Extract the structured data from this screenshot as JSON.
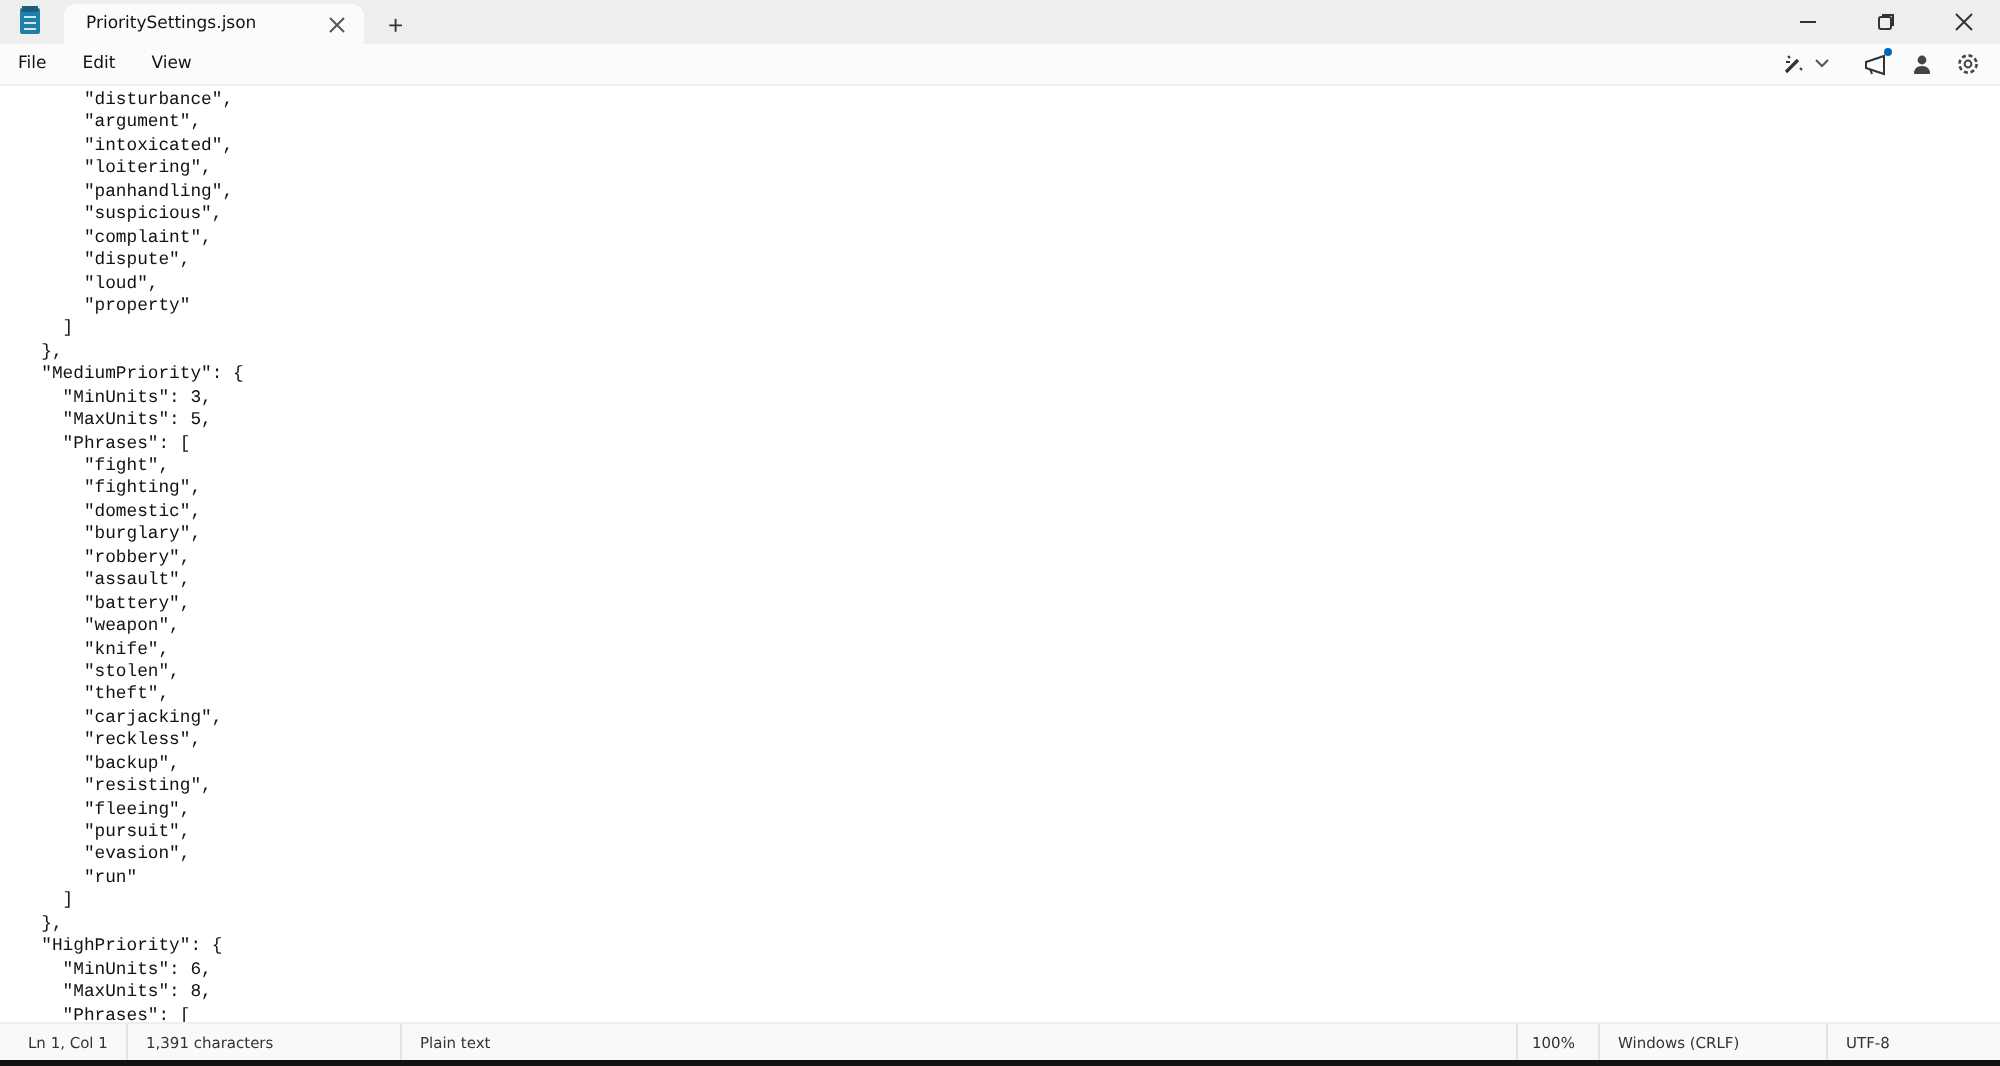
{
  "window": {
    "tab_title": "PrioritySettings.json",
    "tab_selected": true,
    "new_tab": "+"
  },
  "menu": [
    "File",
    "Edit",
    "View"
  ],
  "toolbar": {
    "notification_dot": true
  },
  "editor": {
    "lines": [
      "      \"disturbance\",",
      "      \"argument\",",
      "      \"intoxicated\",",
      "      \"loitering\",",
      "      \"panhandling\",",
      "      \"suspicious\",",
      "      \"complaint\",",
      "      \"dispute\",",
      "      \"loud\",",
      "      \"property\"",
      "    ]",
      "  },",
      "  \"MediumPriority\": {",
      "    \"MinUnits\": 3,",
      "    \"MaxUnits\": 5,",
      "    \"Phrases\": [",
      "      \"fight\",",
      "      \"fighting\",",
      "      \"domestic\",",
      "      \"burglary\",",
      "      \"robbery\",",
      "      \"assault\",",
      "      \"battery\",",
      "      \"weapon\",",
      "      \"knife\",",
      "      \"stolen\",",
      "      \"theft\",",
      "      \"carjacking\",",
      "      \"reckless\",",
      "      \"backup\",",
      "      \"resisting\",",
      "      \"fleeing\",",
      "      \"pursuit\",",
      "      \"evasion\",",
      "      \"run\"",
      "    ]",
      "  },",
      "  \"HighPriority\": {",
      "    \"MinUnits\": 6,",
      "    \"MaxUnits\": 8,",
      "    \"Phrases\": ["
    ]
  },
  "status_bar": {
    "position": "Ln 1, Col 1",
    "characters": "1,391 characters",
    "format": "Plain text",
    "zoom": "100%",
    "line_ending": "Windows (CRLF)",
    "encoding": "UTF-8"
  }
}
